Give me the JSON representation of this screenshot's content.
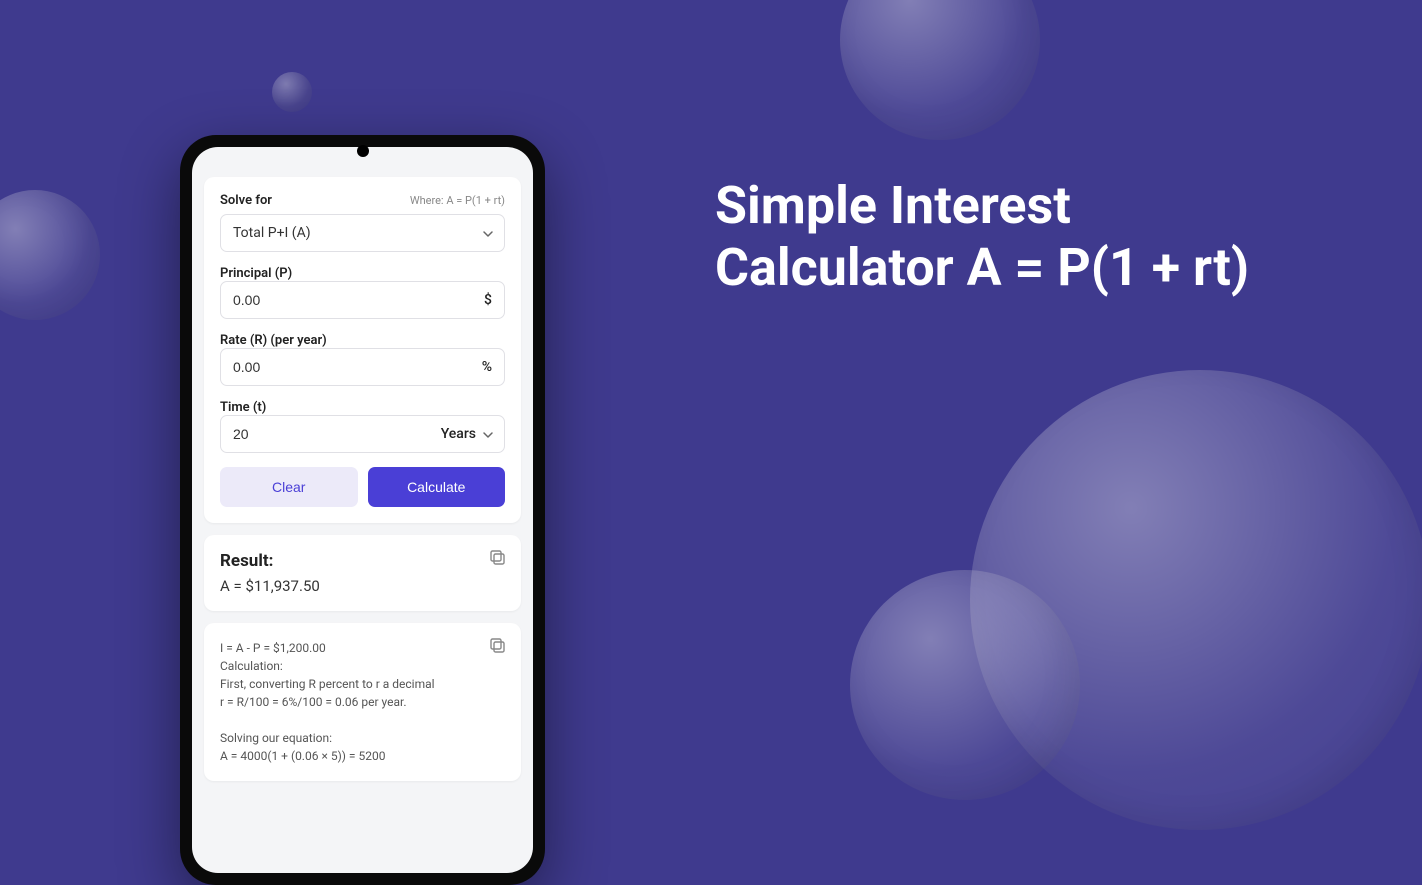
{
  "hero": {
    "line1": "Simple Interest",
    "line2": "Calculator A = P(1 + rt)"
  },
  "form": {
    "solve_label": "Solve for",
    "where": "Where: A = P(1 + rt)",
    "solve_value": "Total P+I (A)",
    "principal_label": "Principal (P)",
    "principal_value": "0.00",
    "principal_suffix": "$",
    "rate_label": "Rate (R) (per year)",
    "rate_value": "0.00",
    "rate_suffix": "%",
    "time_label": "Time (t)",
    "time_value": "20",
    "time_unit": "Years",
    "clear_label": "Clear",
    "calculate_label": "Calculate"
  },
  "result": {
    "title": "Result:",
    "value": "A = $11,937.50"
  },
  "calculation": {
    "text": "I = A - P = $1,200.00\nCalculation:\nFirst, converting R percent to r a decimal\nr = R/100 = 6%/100 = 0.06 per year.\n\nSolving our equation:\nA = 4000(1 + (0.06 × 5)) = 5200"
  }
}
